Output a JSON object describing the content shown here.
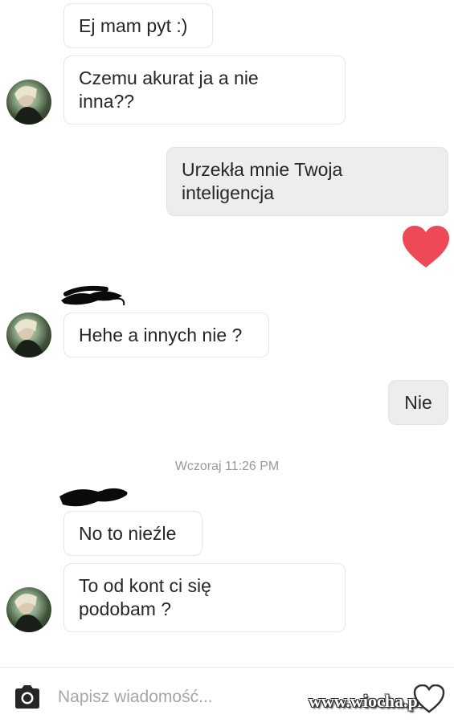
{
  "messages": [
    {
      "side": "in",
      "text": "Ej mam pyt :)"
    },
    {
      "side": "in",
      "text": "Czemu akurat ja a nie\ninna??"
    },
    {
      "side": "out",
      "text": "Urzekła mnie Twoja\ninteligencja"
    },
    {
      "side": "in",
      "text": "Hehe a innych nie ?"
    },
    {
      "side": "out",
      "text": "Nie"
    },
    {
      "side": "in",
      "text": "No to nieźle"
    },
    {
      "side": "in",
      "text": "To od kont ci się\npodobam ?"
    }
  ],
  "timestamp": "Wczoraj 11:26 PM",
  "composer": {
    "placeholder": "Napisz wiadomość...",
    "camera_icon": "camera-icon"
  },
  "reaction": {
    "icon": "heart-icon",
    "color": "#ed4956"
  },
  "watermark": "www.wiocha.pl",
  "colors": {
    "incoming_bg": "#ffffff",
    "outgoing_bg": "#ededed",
    "heart": "#ed4956"
  }
}
